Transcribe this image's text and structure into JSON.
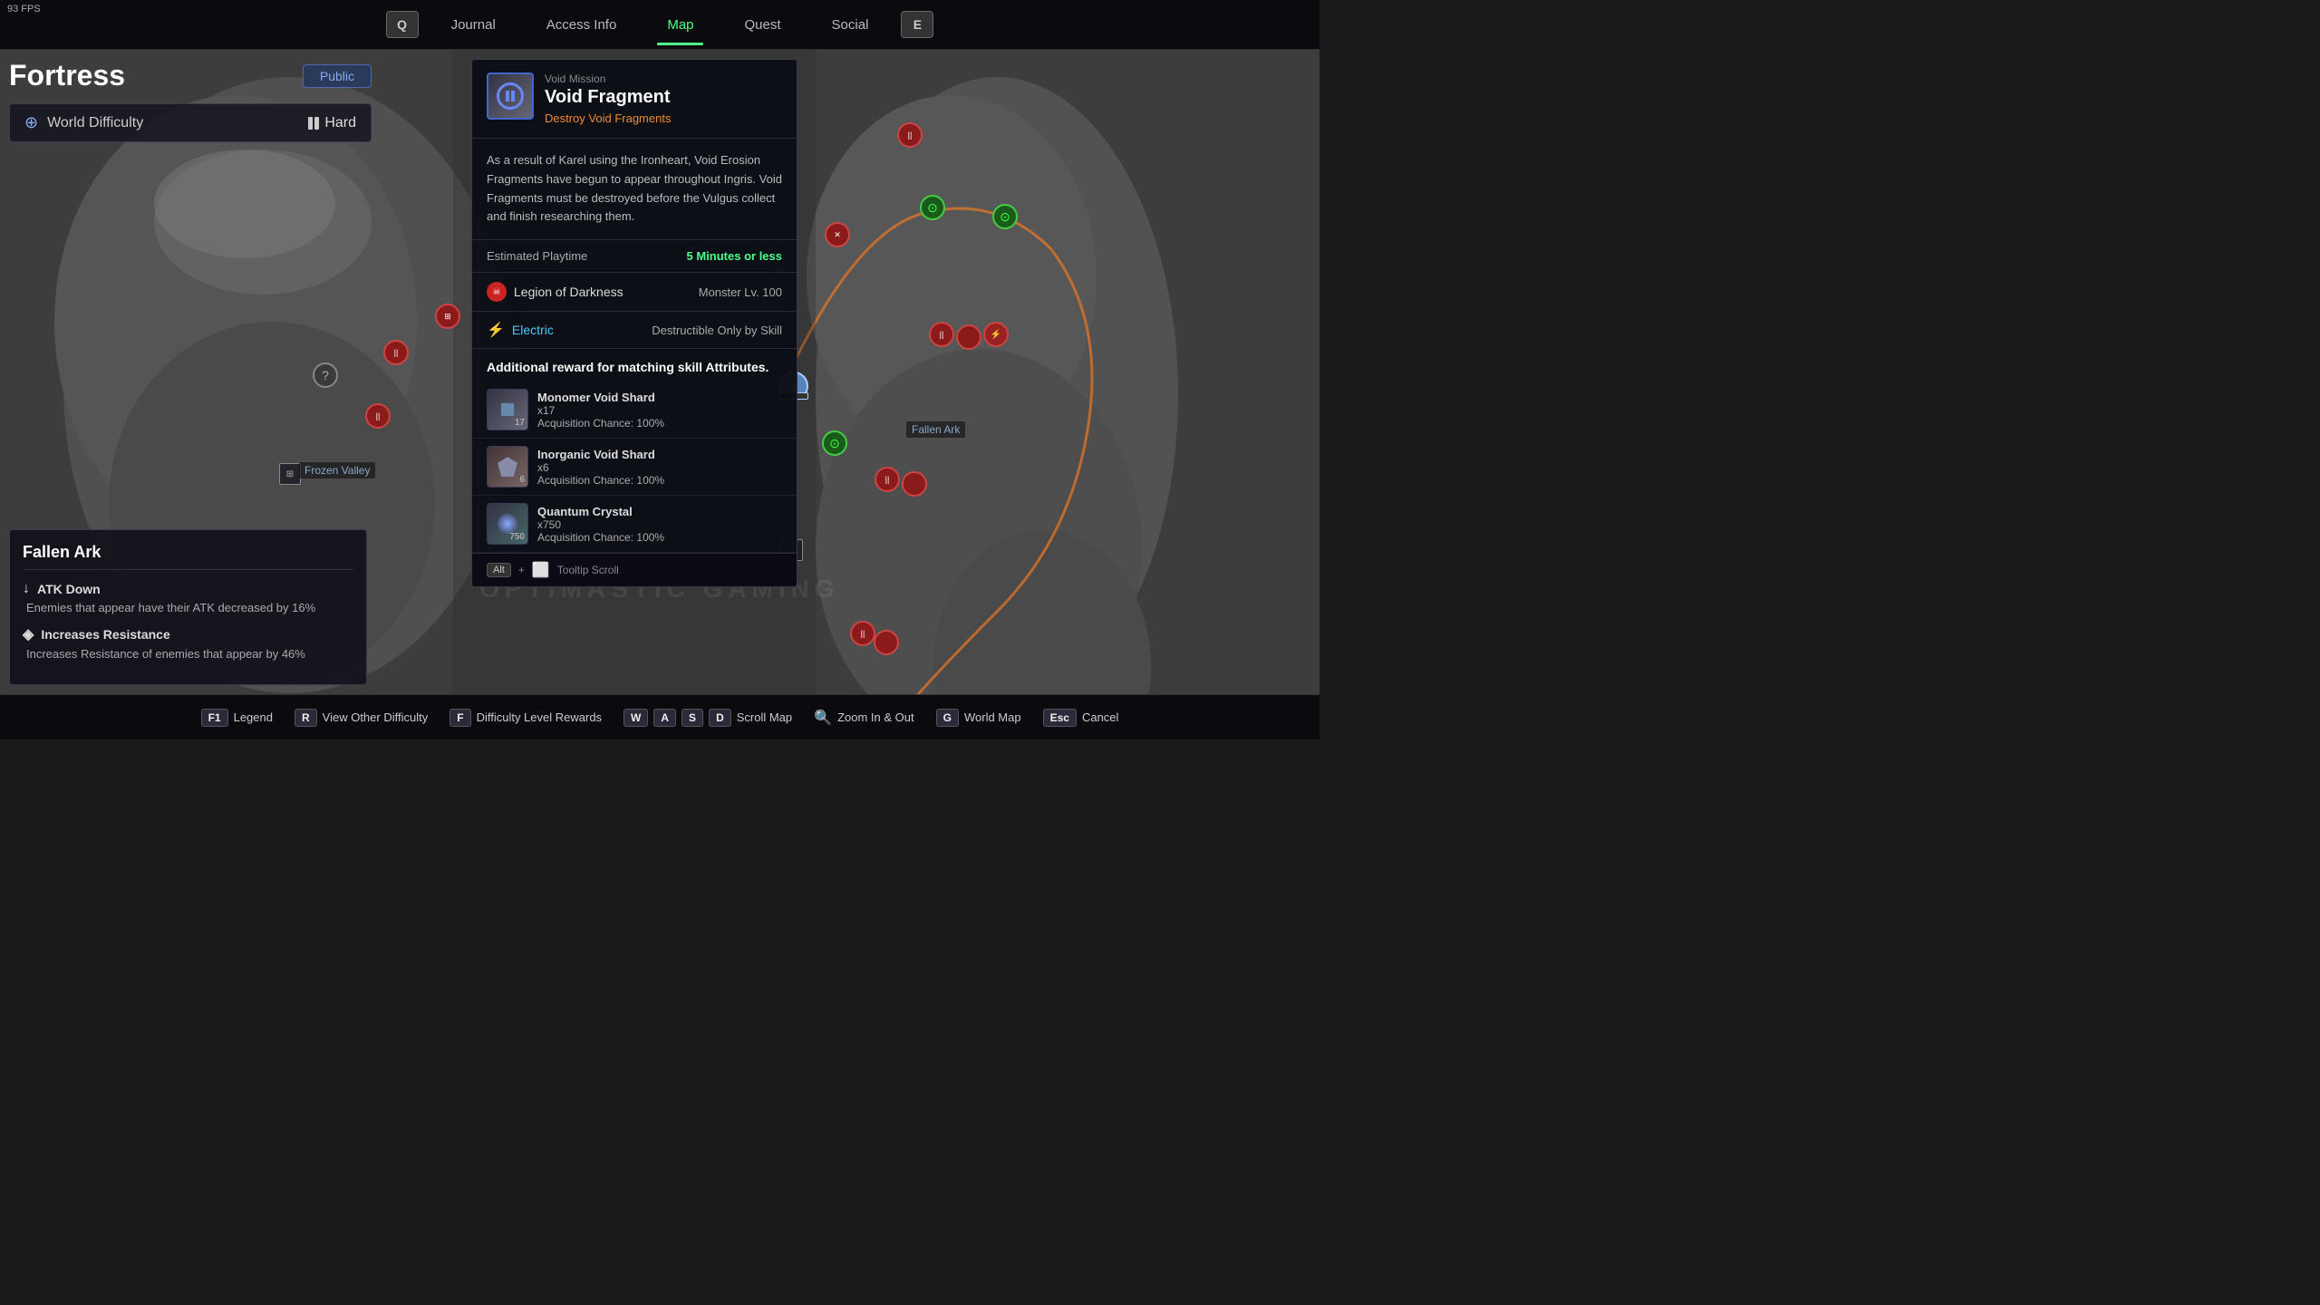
{
  "fps": "93 FPS",
  "nav": {
    "key_left": "Q",
    "key_right": "E",
    "items": [
      {
        "label": "Journal",
        "active": false
      },
      {
        "label": "Access Info",
        "active": false
      },
      {
        "label": "Map",
        "active": true
      },
      {
        "label": "Quest",
        "active": false
      },
      {
        "label": "Social",
        "active": false
      }
    ]
  },
  "left_panel": {
    "title": "Fortress",
    "badge": "Public",
    "difficulty": {
      "label": "World Difficulty",
      "value": "Hard"
    }
  },
  "fallen_ark_box": {
    "title": "Fallen Ark",
    "effects": [
      {
        "icon": "↓",
        "name": "ATK Down",
        "desc": "Enemies that appear have their ATK decreased by 16%"
      },
      {
        "icon": "◈",
        "name": "Increases Resistance",
        "desc": "Increases Resistance of enemies that appear by 46%"
      }
    ]
  },
  "mission": {
    "type": "Void Mission",
    "name": "Void Fragment",
    "objective": "Destroy Void Fragments",
    "desc": "As a result of Karel using the Ironheart, Void Erosion Fragments have begun to appear throughout Ingris. Void Fragments must be destroyed before the Vulgus collect and finish researching them.",
    "playtime_label": "Estimated Playtime",
    "playtime_value": "5 Minutes or less",
    "legion": {
      "name": "Legion of Darkness",
      "level": "Monster Lv. 100"
    },
    "element": {
      "name": "Electric",
      "note": "Destructible Only by Skill"
    },
    "reward_header": "Additional reward for matching skill Attributes.",
    "rewards": [
      {
        "name": "Monomer Void Shard",
        "qty": "x17",
        "chance": "Acquisition Chance: 100%",
        "count_badge": "17"
      },
      {
        "name": "Inorganic Void Shard",
        "qty": "x6",
        "chance": "Acquisition Chance: 100%",
        "count_badge": "6"
      },
      {
        "name": "Quantum Crystal",
        "qty": "x750",
        "chance": "Acquisition Chance: 100%",
        "count_badge": "750"
      }
    ],
    "tooltip_hint": "Alt",
    "tooltip_label": "Tooltip Scroll"
  },
  "map_labels": {
    "frozen_valley": "Frozen Valley",
    "fallen_ark": "Fallen Ark"
  },
  "bottom_bar": {
    "items": [
      {
        "key": "F1",
        "label": "Legend"
      },
      {
        "key": "R",
        "label": "View Other Difficulty"
      },
      {
        "key": "F",
        "label": "Difficulty Level Rewards"
      },
      {
        "keys": [
          "W",
          "A",
          "S",
          "D"
        ],
        "label": "Scroll Map"
      },
      {
        "key": "Zoom In & Out",
        "label": ""
      },
      {
        "key": "G",
        "label": "World Map"
      },
      {
        "key": "Esc",
        "label": "Cancel"
      }
    ]
  }
}
